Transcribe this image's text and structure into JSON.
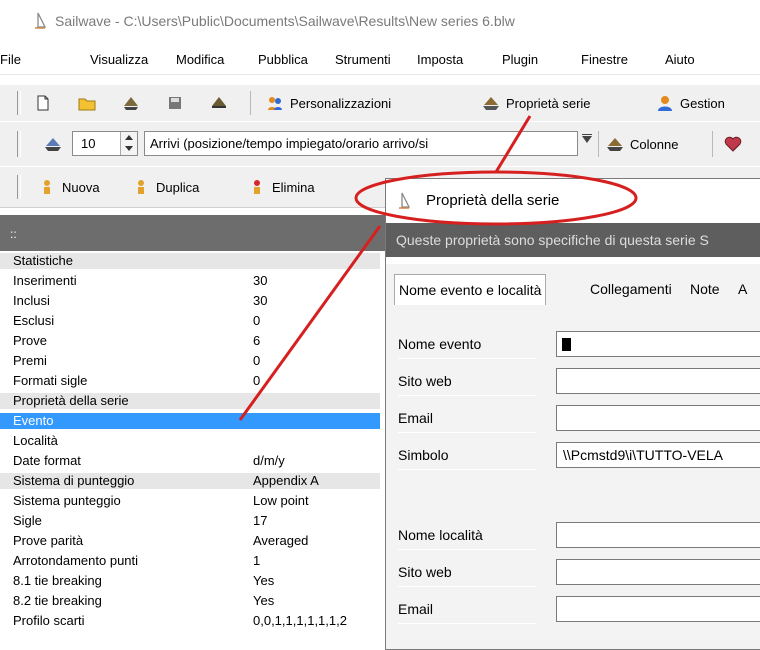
{
  "window": {
    "title": "Sailwave - C:\\Users\\Public\\Documents\\Sailwave\\Results\\New series 6.blw"
  },
  "menu": [
    "File",
    "Visualizza",
    "Modifica",
    "Pubblica",
    "Strumenti",
    "Imposta",
    "Plugin",
    "Finestre",
    "Aiuto"
  ],
  "toolbar1": {
    "personalizzazioni": "Personalizzazioni",
    "proprieta_serie": "Proprietà serie",
    "gestion": "Gestion"
  },
  "toolbar2": {
    "spin_value": "10",
    "combo_value": "Arrivi (posizione/tempo impiegato/orario arrivo/si",
    "colonne": "Colonne"
  },
  "toolbar3": {
    "nuova": "Nuova",
    "duplica": "Duplica",
    "elimina": "Elimina"
  },
  "grid": {
    "header": "::",
    "rows": [
      {
        "k": "Statistiche",
        "v": "",
        "type": "cat"
      },
      {
        "k": "Inserimenti",
        "v": "30",
        "type": ""
      },
      {
        "k": "Inclusi",
        "v": "30",
        "type": ""
      },
      {
        "k": "Esclusi",
        "v": "0",
        "type": ""
      },
      {
        "k": "Prove",
        "v": "6",
        "type": ""
      },
      {
        "k": "Premi",
        "v": "0",
        "type": ""
      },
      {
        "k": "Formati sigle",
        "v": "0",
        "type": ""
      },
      {
        "k": "Proprietà della serie",
        "v": "",
        "type": "cat"
      },
      {
        "k": "Evento",
        "v": "",
        "type": "sel"
      },
      {
        "k": "Località",
        "v": "",
        "type": ""
      },
      {
        "k": "Date format",
        "v": "d/m/y",
        "type": ""
      },
      {
        "k": "Sistema di punteggio",
        "v": "Appendix A",
        "type": "cat"
      },
      {
        "k": "Sistema punteggio",
        "v": "Low point",
        "type": ""
      },
      {
        "k": "Sigle",
        "v": "17",
        "type": ""
      },
      {
        "k": "Prove parità",
        "v": "Averaged",
        "type": ""
      },
      {
        "k": "Arrotondamento punti",
        "v": "1",
        "type": ""
      },
      {
        "k": "8.1 tie breaking",
        "v": "Yes",
        "type": ""
      },
      {
        "k": "8.2 tie breaking",
        "v": "Yes",
        "type": ""
      },
      {
        "k": "Profilo scarti",
        "v": "0,0,1,1,1,1,1,1,2",
        "type": ""
      }
    ]
  },
  "dialog": {
    "title": "Proprietà della serie",
    "banner": "Queste proprietà sono specifiche di questa serie S",
    "tabs": [
      "Nome evento e località",
      "Collegamenti",
      "Note",
      "A"
    ],
    "fields": [
      {
        "label": "Nome evento",
        "value": ""
      },
      {
        "label": "Sito web",
        "value": ""
      },
      {
        "label": "Email",
        "value": ""
      },
      {
        "label": "Simbolo",
        "value": "\\\\Pcmstd9\\i\\TUTTO-VELA"
      },
      {
        "label": "Nome località",
        "value": ""
      },
      {
        "label": "Sito web",
        "value": ""
      },
      {
        "label": "Email",
        "value": ""
      }
    ]
  },
  "annotation": {
    "color": "#d62020"
  }
}
